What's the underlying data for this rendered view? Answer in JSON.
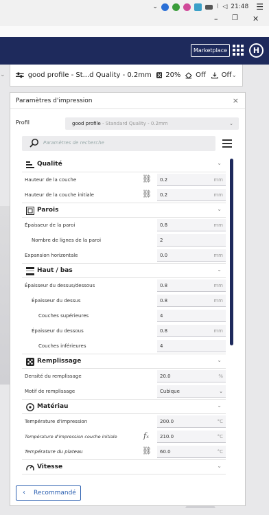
{
  "system": {
    "clock": "21:48",
    "window_controls": {
      "minimize": "–",
      "restore": "❐",
      "close": "✕"
    }
  },
  "header": {
    "marketplace_label": "Marketplace",
    "avatar_initial": "H",
    "accent_color": "#1e2a5c"
  },
  "print_bar": {
    "profile_label": "good profile - St...d Quality - 0.2mm",
    "infill_label": "20%",
    "support_label": "Off",
    "adhesion_label": "Off"
  },
  "panel": {
    "title": "Paramètres d'impression",
    "close_label": "×",
    "profile_label": "Profil",
    "profile_name": "good profile",
    "profile_sub": " - Standard Quality - 0.2mm",
    "search_placeholder": "Paramètres de recherche",
    "recommend_label": "Recommandé",
    "categories": {
      "quality": "Qualité",
      "walls": "Parois",
      "topbottom": "Haut / bas",
      "infill": "Remplissage",
      "material": "Matériau",
      "speed": "Vitesse"
    },
    "settings": [
      {
        "label": "Hauteur de la couche",
        "value": "0.2",
        "unit": "mm",
        "icon": "link-icon"
      },
      {
        "label": "Hauteur de la couche initiale",
        "value": "0.2",
        "unit": "mm",
        "icon": "link-icon"
      },
      {
        "label": "Épaisseur de la paroi",
        "value": "0.8",
        "unit": "mm",
        "icon": ""
      },
      {
        "label": "Nombre de lignes de la paroi",
        "value": "2",
        "unit": "",
        "icon": ""
      },
      {
        "label": "Expansion horizontale",
        "value": "0.0",
        "unit": "mm",
        "icon": ""
      },
      {
        "label": "Épaisseur du dessus/dessous",
        "value": "0.8",
        "unit": "mm",
        "icon": ""
      },
      {
        "label": "Épaisseur du dessus",
        "value": "0.8",
        "unit": "mm",
        "icon": ""
      },
      {
        "label": "Couches supérieures",
        "value": "4",
        "unit": "",
        "icon": ""
      },
      {
        "label": "Épaisseur du dessous",
        "value": "0.8",
        "unit": "mm",
        "icon": ""
      },
      {
        "label": "Couches inférieures",
        "value": "4",
        "unit": "",
        "icon": ""
      },
      {
        "label": "Densité du remplissage",
        "value": "20.0",
        "unit": "%",
        "icon": ""
      },
      {
        "label": "Motif de remplissage",
        "value": "Cubique",
        "unit": "",
        "icon": "chevron-down-icon"
      },
      {
        "label": "Température d'impression",
        "value": "200.0",
        "unit": "°C",
        "icon": ""
      },
      {
        "label": "Température d'impression couche initiale",
        "value": "210.0",
        "unit": "°C",
        "icon": "function-icon"
      },
      {
        "label": "Température du plateau",
        "value": "60.0",
        "unit": "°C",
        "icon": "link-icon"
      }
    ]
  }
}
